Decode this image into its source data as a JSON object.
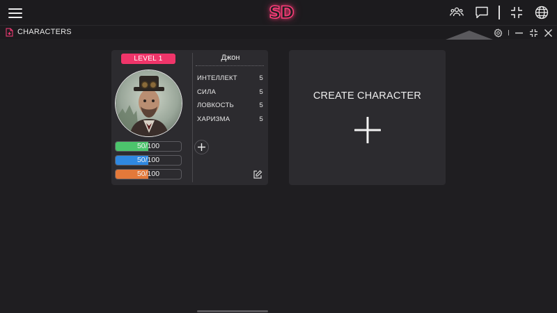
{
  "app": {
    "logo_text": "SD",
    "accent_color": "#ff3d7a",
    "icons": [
      "menu-icon",
      "users-icon",
      "chat-icon",
      "collapse-icon",
      "globe-icon"
    ]
  },
  "window": {
    "title": "CHARACTERS",
    "icons": [
      "document-icon",
      "gear-icon",
      "minimize-icon",
      "collapse-icon",
      "close-icon"
    ]
  },
  "character": {
    "level": "LEVEL 1",
    "name": "Джон",
    "stats": [
      {
        "label": "ИНТЕЛЛЕКТ",
        "value": "5"
      },
      {
        "label": "СИЛА",
        "value": "5"
      },
      {
        "label": "ЛОВКОСТЬ",
        "value": "5"
      },
      {
        "label": "ХАРИЗМА",
        "value": "5"
      }
    ],
    "bars": [
      {
        "text": "50/100",
        "current": 50,
        "max": 100,
        "color": "#4cc46c"
      },
      {
        "text": "50/100",
        "current": 50,
        "max": 100,
        "color": "#2f88e0"
      },
      {
        "text": "50/100",
        "current": 50,
        "max": 100,
        "color": "#e3793a"
      }
    ]
  },
  "create": {
    "label": "CREATE CHARACTER"
  }
}
